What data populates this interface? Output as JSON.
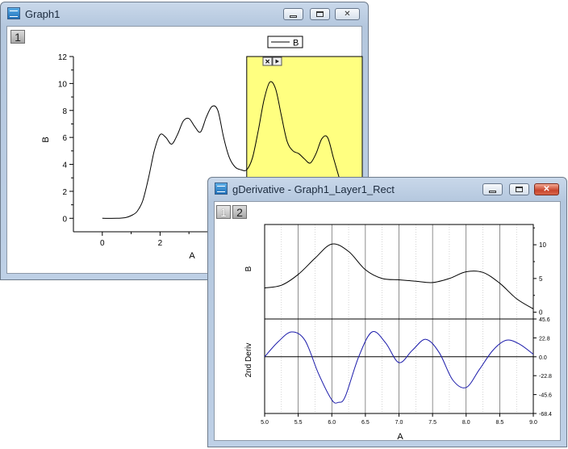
{
  "graph1": {
    "title": "Graph1",
    "layer_tab": "1",
    "legend": "B",
    "chart_data": {
      "type": "line",
      "xlabel": "A",
      "ylabel": "B",
      "xlim": [
        -1,
        9
      ],
      "ylim": [
        -1,
        12
      ],
      "xticks": [
        "0",
        "2",
        "4"
      ],
      "yticks": [
        "0",
        "2",
        "4",
        "6",
        "8",
        "10",
        "12"
      ],
      "highlight_region": {
        "x_start": 5,
        "x_end": 9,
        "color": "#ffff80"
      },
      "series": [
        {
          "color": "#000000",
          "x": [
            0,
            0.5,
            0.8,
            1.0,
            1.2,
            1.4,
            1.6,
            1.8,
            2.0,
            2.2,
            2.4,
            2.6,
            2.8,
            3.0,
            3.2,
            3.4,
            3.6,
            3.8,
            4.0,
            4.2,
            4.4,
            4.6,
            4.8,
            5.0,
            5.2,
            5.4,
            5.6,
            5.8,
            6.0,
            6.2,
            6.4,
            6.6,
            6.8,
            7.0,
            7.2,
            7.4,
            7.6,
            7.8,
            8.0,
            8.2
          ],
          "y": [
            0,
            0,
            0.05,
            0.2,
            0.5,
            1.3,
            3.0,
            5.0,
            6.2,
            6.0,
            5.5,
            6.2,
            7.2,
            7.4,
            6.8,
            6.4,
            7.5,
            8.3,
            8.0,
            6.0,
            4.5,
            3.8,
            3.6,
            3.6,
            4.5,
            6.5,
            8.8,
            10.1,
            9.6,
            7.6,
            5.7,
            5.0,
            4.8,
            4.4,
            4.1,
            4.8,
            5.9,
            6.0,
            4.5,
            3.0
          ]
        }
      ]
    }
  },
  "gderivative": {
    "title": "gDerivative - Graph1_Layer1_Rect",
    "layer_tabs": [
      "1",
      "2"
    ],
    "top_chart": {
      "type": "line",
      "ylabel": "B",
      "xlim": [
        5.0,
        9.0
      ],
      "ylim": [
        -1,
        13
      ],
      "yticks_right": [
        "0",
        "5",
        "10"
      ],
      "x": [
        5.0,
        5.25,
        5.5,
        5.75,
        6.0,
        6.25,
        6.5,
        6.75,
        7.0,
        7.25,
        7.5,
        7.75,
        8.0,
        8.25,
        8.5,
        8.75,
        9.0
      ],
      "y": [
        3.6,
        4.0,
        5.6,
        8.0,
        10.1,
        9.0,
        6.3,
        5.0,
        4.8,
        4.6,
        4.4,
        5.0,
        6.0,
        5.9,
        4.3,
        2.0,
        0.5
      ]
    },
    "bottom_chart": {
      "type": "line",
      "ylabel": "2nd Deriv",
      "xlabel": "A",
      "xlim": [
        5.0,
        9.0
      ],
      "ylim": [
        -68.4,
        45.6
      ],
      "yticks_right": [
        "45.6",
        "22.8",
        "0.0",
        "-22.8",
        "-45.6",
        "-68.4"
      ],
      "xticks": [
        "5.0",
        "5.5",
        "6.0",
        "6.5",
        "7.0",
        "7.5",
        "8.0",
        "8.5",
        "9.0"
      ],
      "series_color": "#1a1aaa",
      "x": [
        5.0,
        5.2,
        5.4,
        5.6,
        5.8,
        6.0,
        6.1,
        6.2,
        6.4,
        6.6,
        6.8,
        7.0,
        7.2,
        7.4,
        7.6,
        7.8,
        8.0,
        8.2,
        8.4,
        8.6,
        8.8,
        9.0
      ],
      "y": [
        0,
        18,
        30,
        20,
        -20,
        -52,
        -55,
        -48,
        0,
        30,
        17,
        -7,
        8,
        21,
        5,
        -28,
        -37,
        -15,
        8,
        20,
        15,
        3
      ]
    }
  }
}
